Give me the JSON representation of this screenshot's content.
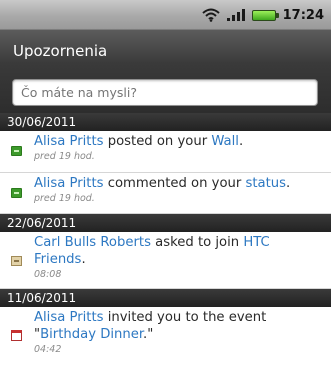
{
  "status_bar": {
    "time": "17:24",
    "icons": [
      "wifi-icon",
      "signal-icon",
      "battery-icon"
    ]
  },
  "header": {
    "title": "Upozornenia",
    "status_placeholder": "Čo máte na mysli?"
  },
  "groups": [
    {
      "date": "30/06/2011",
      "items": [
        {
          "icon": "wall-post-icon",
          "actor": "Alisa Pritts",
          "text": " posted on your ",
          "target": "Wall",
          "suffix": ".",
          "time": "pred 19 hod."
        },
        {
          "icon": "comment-icon",
          "actor": "Alisa Pritts",
          "text": " commented on your ",
          "target": "status",
          "suffix": ".",
          "time": "pred 19 hod."
        }
      ]
    },
    {
      "date": "22/06/2011",
      "items": [
        {
          "icon": "friend-request-icon",
          "actor": "Carl Bulls Roberts",
          "text": " asked to join ",
          "target": "HTC Friends",
          "suffix": ".",
          "time": "08:08"
        }
      ]
    },
    {
      "date": "11/06/2011",
      "items": [
        {
          "icon": "event-invite-icon",
          "actor": "Alisa Pritts",
          "text": " invited you to the event \"",
          "target": "Birthday Dinner",
          "suffix": ".\"",
          "time": "04:42"
        }
      ]
    }
  ],
  "colors": {
    "link": "#2d78c2",
    "title_bar": "#2d2d2d",
    "date_header": "#222222",
    "status_bar": "#a9a9a9"
  }
}
